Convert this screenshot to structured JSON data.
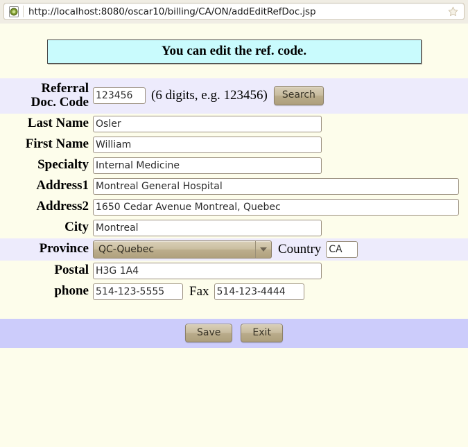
{
  "browser": {
    "url": "http://localhost:8080/oscar10/billing/CA/ON/addEditRefDoc.jsp",
    "favicon": "page-globe-icon",
    "bookmark_icon": "star-icon"
  },
  "banner": {
    "message": "You can edit the ref. code."
  },
  "form": {
    "refcode": {
      "label": "Referral Doc. Code",
      "label_line1": "Referral",
      "label_line2": "Doc. Code",
      "value": "123456",
      "hint": "(6 digits, e.g. 123456)",
      "search_label": "Search"
    },
    "last_name": {
      "label": "Last Name",
      "value": "Osler"
    },
    "first_name": {
      "label": "First Name",
      "value": "William"
    },
    "specialty": {
      "label": "Specialty",
      "value": "Internal Medicine"
    },
    "address1": {
      "label": "Address1",
      "value": "Montreal General Hospital"
    },
    "address2": {
      "label": "Address2",
      "value": "1650 Cedar Avenue Montreal, Quebec"
    },
    "city": {
      "label": "City",
      "value": "Montreal"
    },
    "province": {
      "label": "Province",
      "value": "QC-Quebec"
    },
    "country": {
      "label": "Country",
      "value": "CA"
    },
    "postal": {
      "label": "Postal",
      "value": "H3G 1A4"
    },
    "phone": {
      "label": "phone",
      "value": "514-123-5555"
    },
    "fax": {
      "label": "Fax",
      "value": "514-123-4444"
    }
  },
  "footer": {
    "save_label": "Save",
    "exit_label": "Exit"
  },
  "colors": {
    "page_background": "#FDFDEB",
    "banner_background": "#C9FBFD",
    "row_highlight": "#EDEBFC",
    "footer_background": "#CCCCFB",
    "button_face": "#C8BC9F",
    "input_border": "#9A8F7E"
  }
}
